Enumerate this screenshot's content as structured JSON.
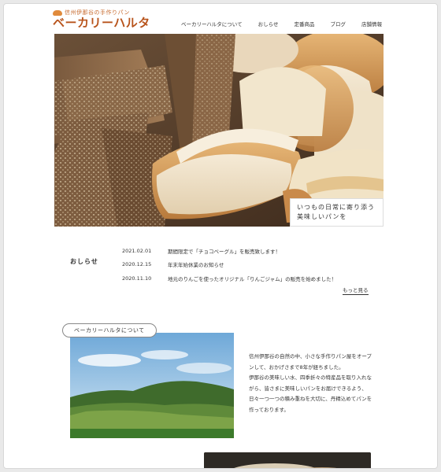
{
  "header": {
    "logo_tagline": "信州伊那谷の手作りパン",
    "logo_name": "ベーカリーハルタ",
    "nav": [
      "ベーカリーハルタについて",
      "おしらせ",
      "定番商品",
      "ブログ",
      "店舗情報"
    ]
  },
  "hero": {
    "caption_line1": "いつもの日常に寄り添う",
    "caption_line2": "美味しいパンを"
  },
  "news": {
    "title": "おしらせ",
    "items": [
      {
        "date": "2021.02.01",
        "text": "期間限定で「チョコベーグル」を販売致します！"
      },
      {
        "date": "2020.12.15",
        "text": "年末年始休業のお知らせ"
      },
      {
        "date": "2020.11.10",
        "text": "地元のりんごを使ったオリジナル「りんごジャム」の販売を始めました！"
      }
    ],
    "more": "もっと見る"
  },
  "about": {
    "label": "ベーカリーハルタについて",
    "lines": [
      "信州伊那谷の自然の中、小さな手作りパン屋をオープ",
      "ンして、おかげさまで8年が経ちました。",
      "伊那谷の美味しい水、四季折々の特産品を取り入れな",
      "がら、皆さまに美味しいパンをお届けできるよう、",
      "日々一つ一つの積み重ねを大切に、丹精込めてパンを",
      "作っております。"
    ]
  },
  "colors": {
    "brand": "#b8541c",
    "accent": "#e08a3c"
  }
}
